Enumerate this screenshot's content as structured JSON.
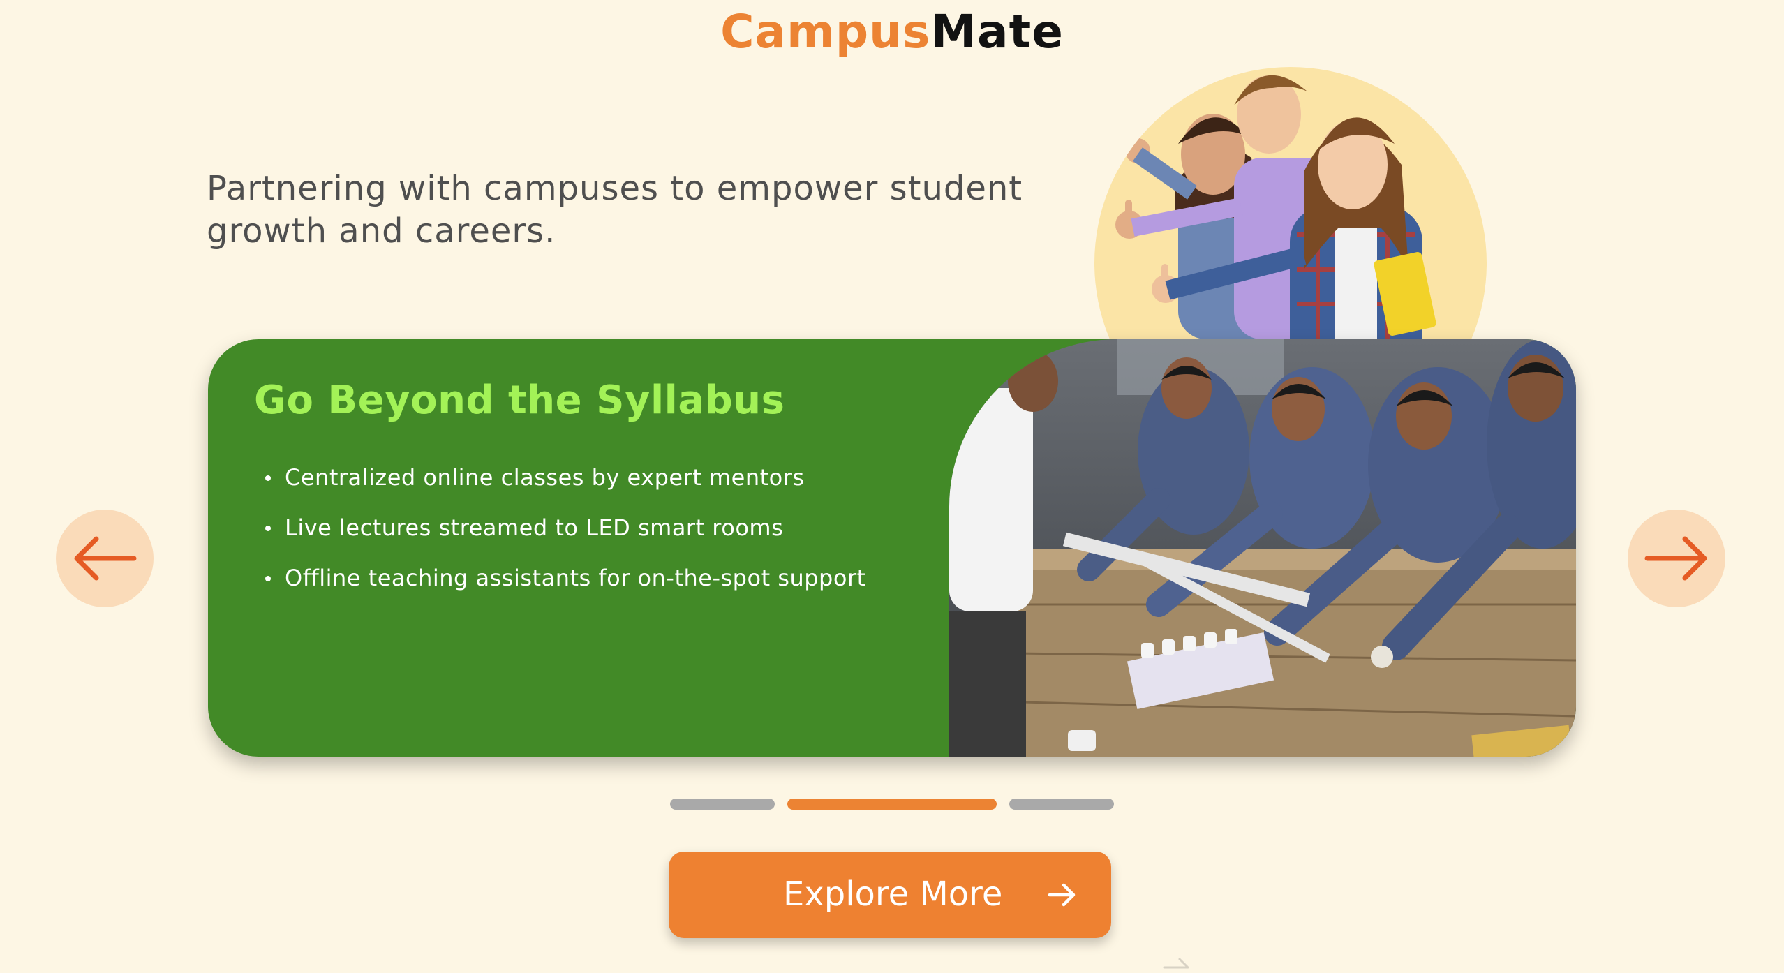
{
  "brand": {
    "part1": "Campus",
    "part2": "Mate"
  },
  "tagline": "Partnering with campuses to empower student growth and careers.",
  "slide": {
    "title": "Go Beyond the Syllabus",
    "bullets": [
      "Centralized online classes by expert mentors",
      "Live lectures streamed to LED smart rooms",
      "Offline teaching assistants for on-the-spot support"
    ]
  },
  "carousel": {
    "total_slides": 3,
    "active_index": 1,
    "prev_icon": "arrow-left-icon",
    "next_icon": "arrow-right-icon"
  },
  "cta": {
    "label": "Explore More",
    "icon": "arrow-right-icon"
  },
  "colors": {
    "background": "#fdf6e4",
    "accent": "#ec8333",
    "card_green": "#428a27",
    "title_green": "#a3f257",
    "nav_button_bg": "#fadbb9",
    "dot_inactive": "#a9a9a9"
  }
}
